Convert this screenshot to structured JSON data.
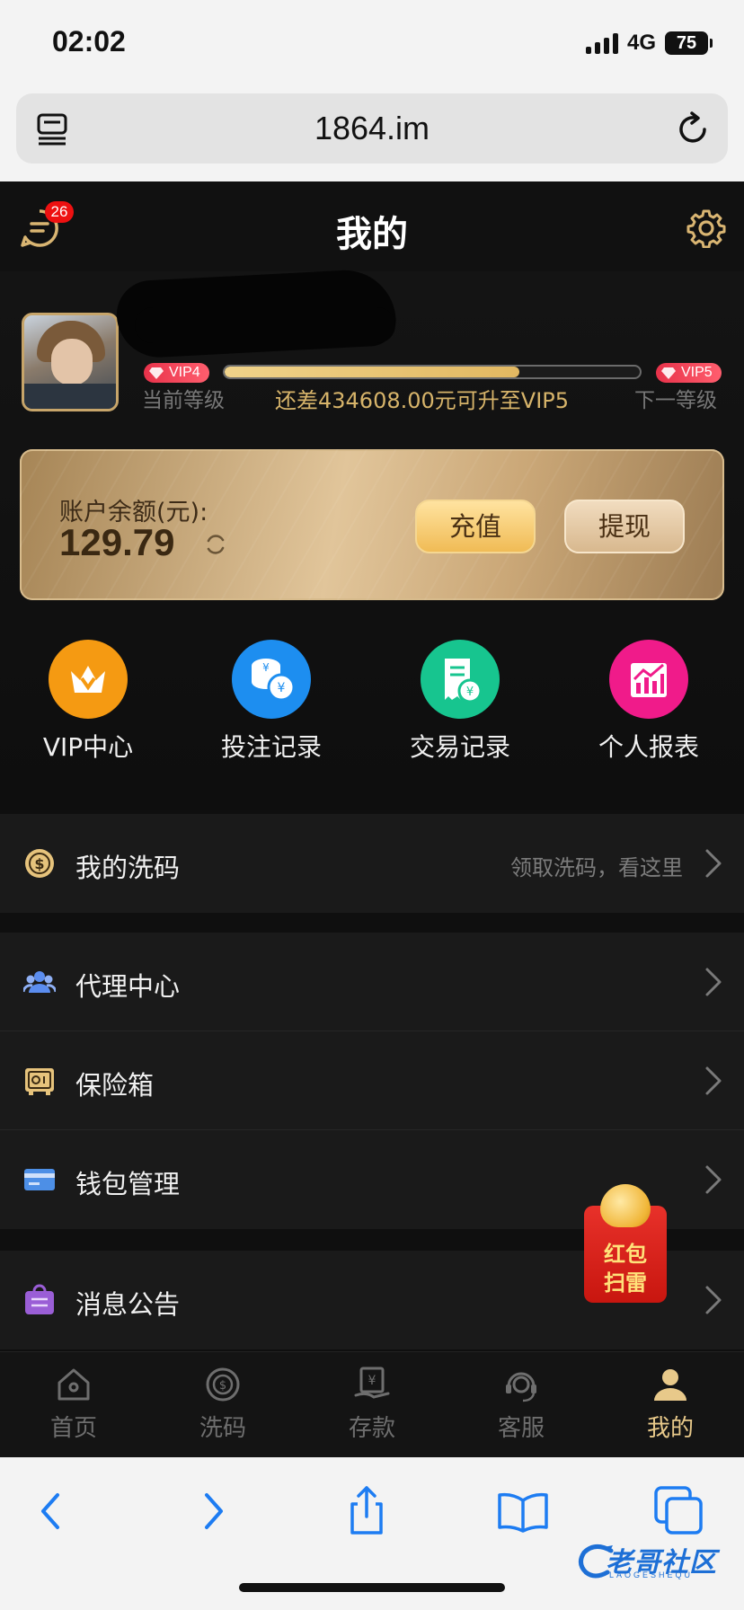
{
  "status_bar": {
    "time": "02:02",
    "network": "4G",
    "battery": "75"
  },
  "browser": {
    "url": "1864.im"
  },
  "header": {
    "title": "我的",
    "message_badge": "26"
  },
  "profile": {
    "current_level_badge": "VIP4",
    "next_level_badge": "VIP5",
    "current_level_label": "当前等级",
    "next_level_label": "下一等级",
    "upgrade_hint": "还差434608.00元可升至VIP5",
    "progress_fraction": 0.71
  },
  "balance": {
    "label": "账户余额(元):",
    "value": "129.79",
    "deposit_label": "充值",
    "withdraw_label": "提现"
  },
  "quick_actions": [
    {
      "label": "VIP中心",
      "icon": "crown-icon",
      "color": "#f59a12"
    },
    {
      "label": "投注记录",
      "icon": "coins-icon",
      "color": "#1d8ef0"
    },
    {
      "label": "交易记录",
      "icon": "receipt-icon",
      "color": "#17c58f"
    },
    {
      "label": "个人报表",
      "icon": "chart-icon",
      "color": "#f01b8a"
    }
  ],
  "rebate": {
    "label": "我的洗码",
    "hint": "领取洗码，看这里"
  },
  "menu": [
    {
      "label": "代理中心",
      "icon": "agents-icon"
    },
    {
      "label": "保险箱",
      "icon": "safe-icon"
    },
    {
      "label": "钱包管理",
      "icon": "wallet-icon"
    }
  ],
  "notices": {
    "label": "消息公告"
  },
  "red_packet": {
    "line1": "红包",
    "line2": "扫雷"
  },
  "tabs": [
    {
      "label": "首页",
      "icon": "home-icon"
    },
    {
      "label": "洗码",
      "icon": "rebate-icon"
    },
    {
      "label": "存款",
      "icon": "deposit-icon"
    },
    {
      "label": "客服",
      "icon": "support-icon"
    },
    {
      "label": "我的",
      "icon": "profile-icon",
      "active": true
    }
  ],
  "watermark": {
    "text": "老哥社区",
    "sub": "LAOGESHEQU"
  },
  "colors": {
    "accent_gold": "#e8c98a",
    "badge_red": "#e11111"
  }
}
